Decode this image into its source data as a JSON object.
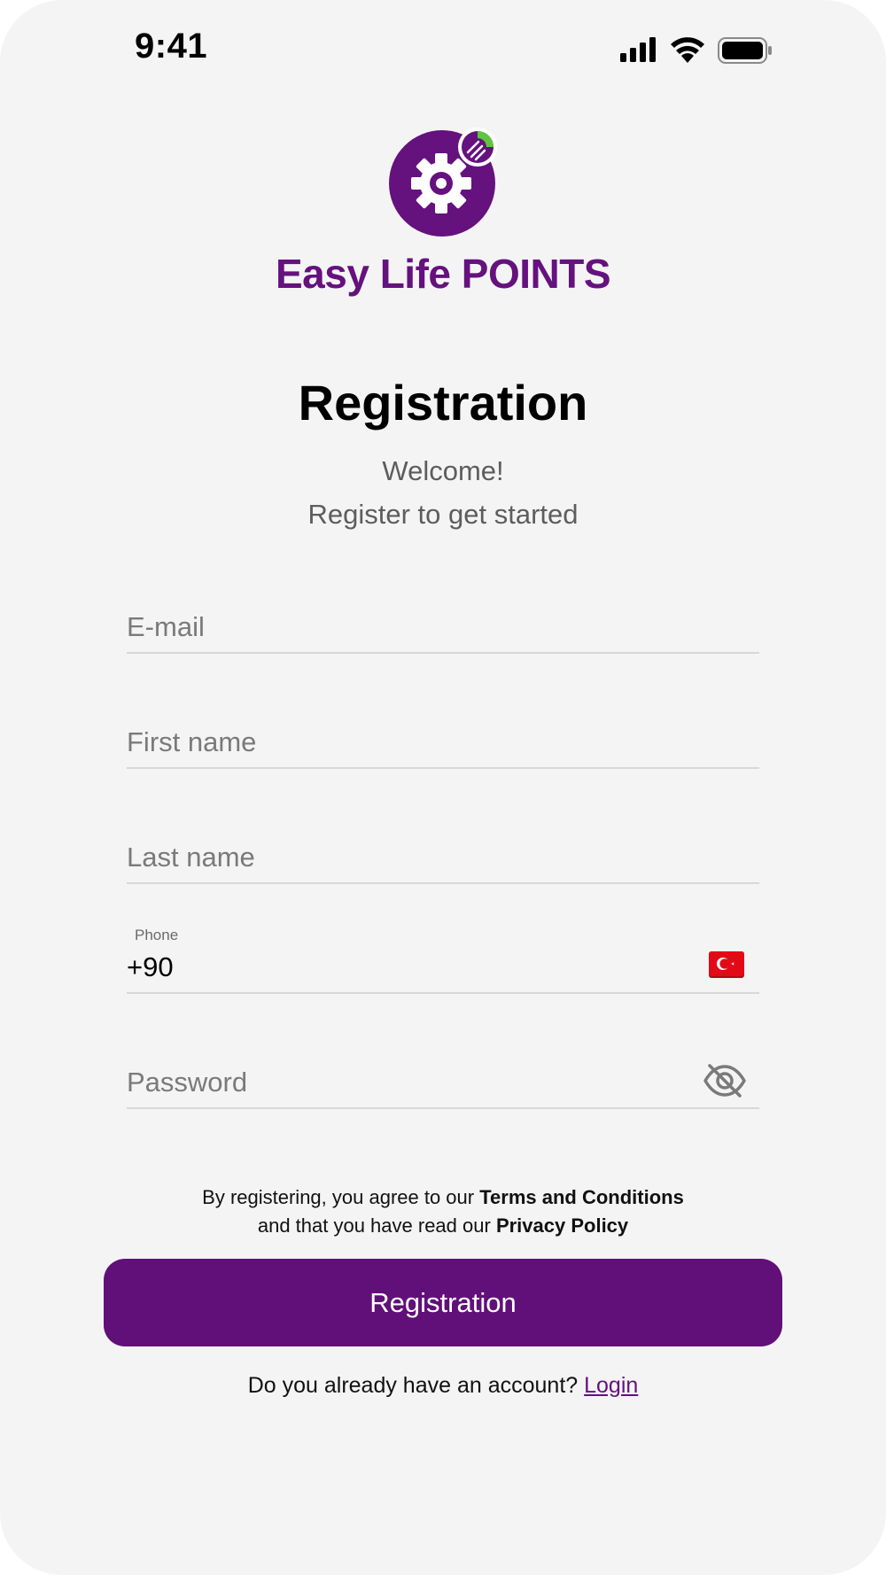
{
  "status_bar": {
    "time": "9:41",
    "icons": [
      "signal-icon",
      "wifi-icon",
      "battery-icon"
    ]
  },
  "brand": {
    "name": "Easy Life POINTS",
    "logo_icon": "gear-logo-icon",
    "primary_color": "#611079",
    "accent_color": "#5cc63f"
  },
  "header": {
    "title": "Registration",
    "welcome": "Welcome!",
    "subtitle": "Register to get started"
  },
  "form": {
    "email": {
      "placeholder": "E-mail",
      "value": ""
    },
    "first_name": {
      "placeholder": "First name",
      "value": ""
    },
    "last_name": {
      "placeholder": "Last name",
      "value": ""
    },
    "phone": {
      "label": "Phone",
      "value": "+90",
      "country_flag": "turkey-flag-icon"
    },
    "password": {
      "placeholder": "Password",
      "value": "",
      "toggle_icon": "eye-off-icon"
    }
  },
  "terms": {
    "prefix": "By registering, you agree to our ",
    "terms_link": "Terms and Conditions",
    "middle": "and that you have read our ",
    "privacy_link": "Privacy Policy"
  },
  "actions": {
    "register_label": "Registration"
  },
  "footer": {
    "question": "Do you already have an account? ",
    "login_label": "Login"
  }
}
